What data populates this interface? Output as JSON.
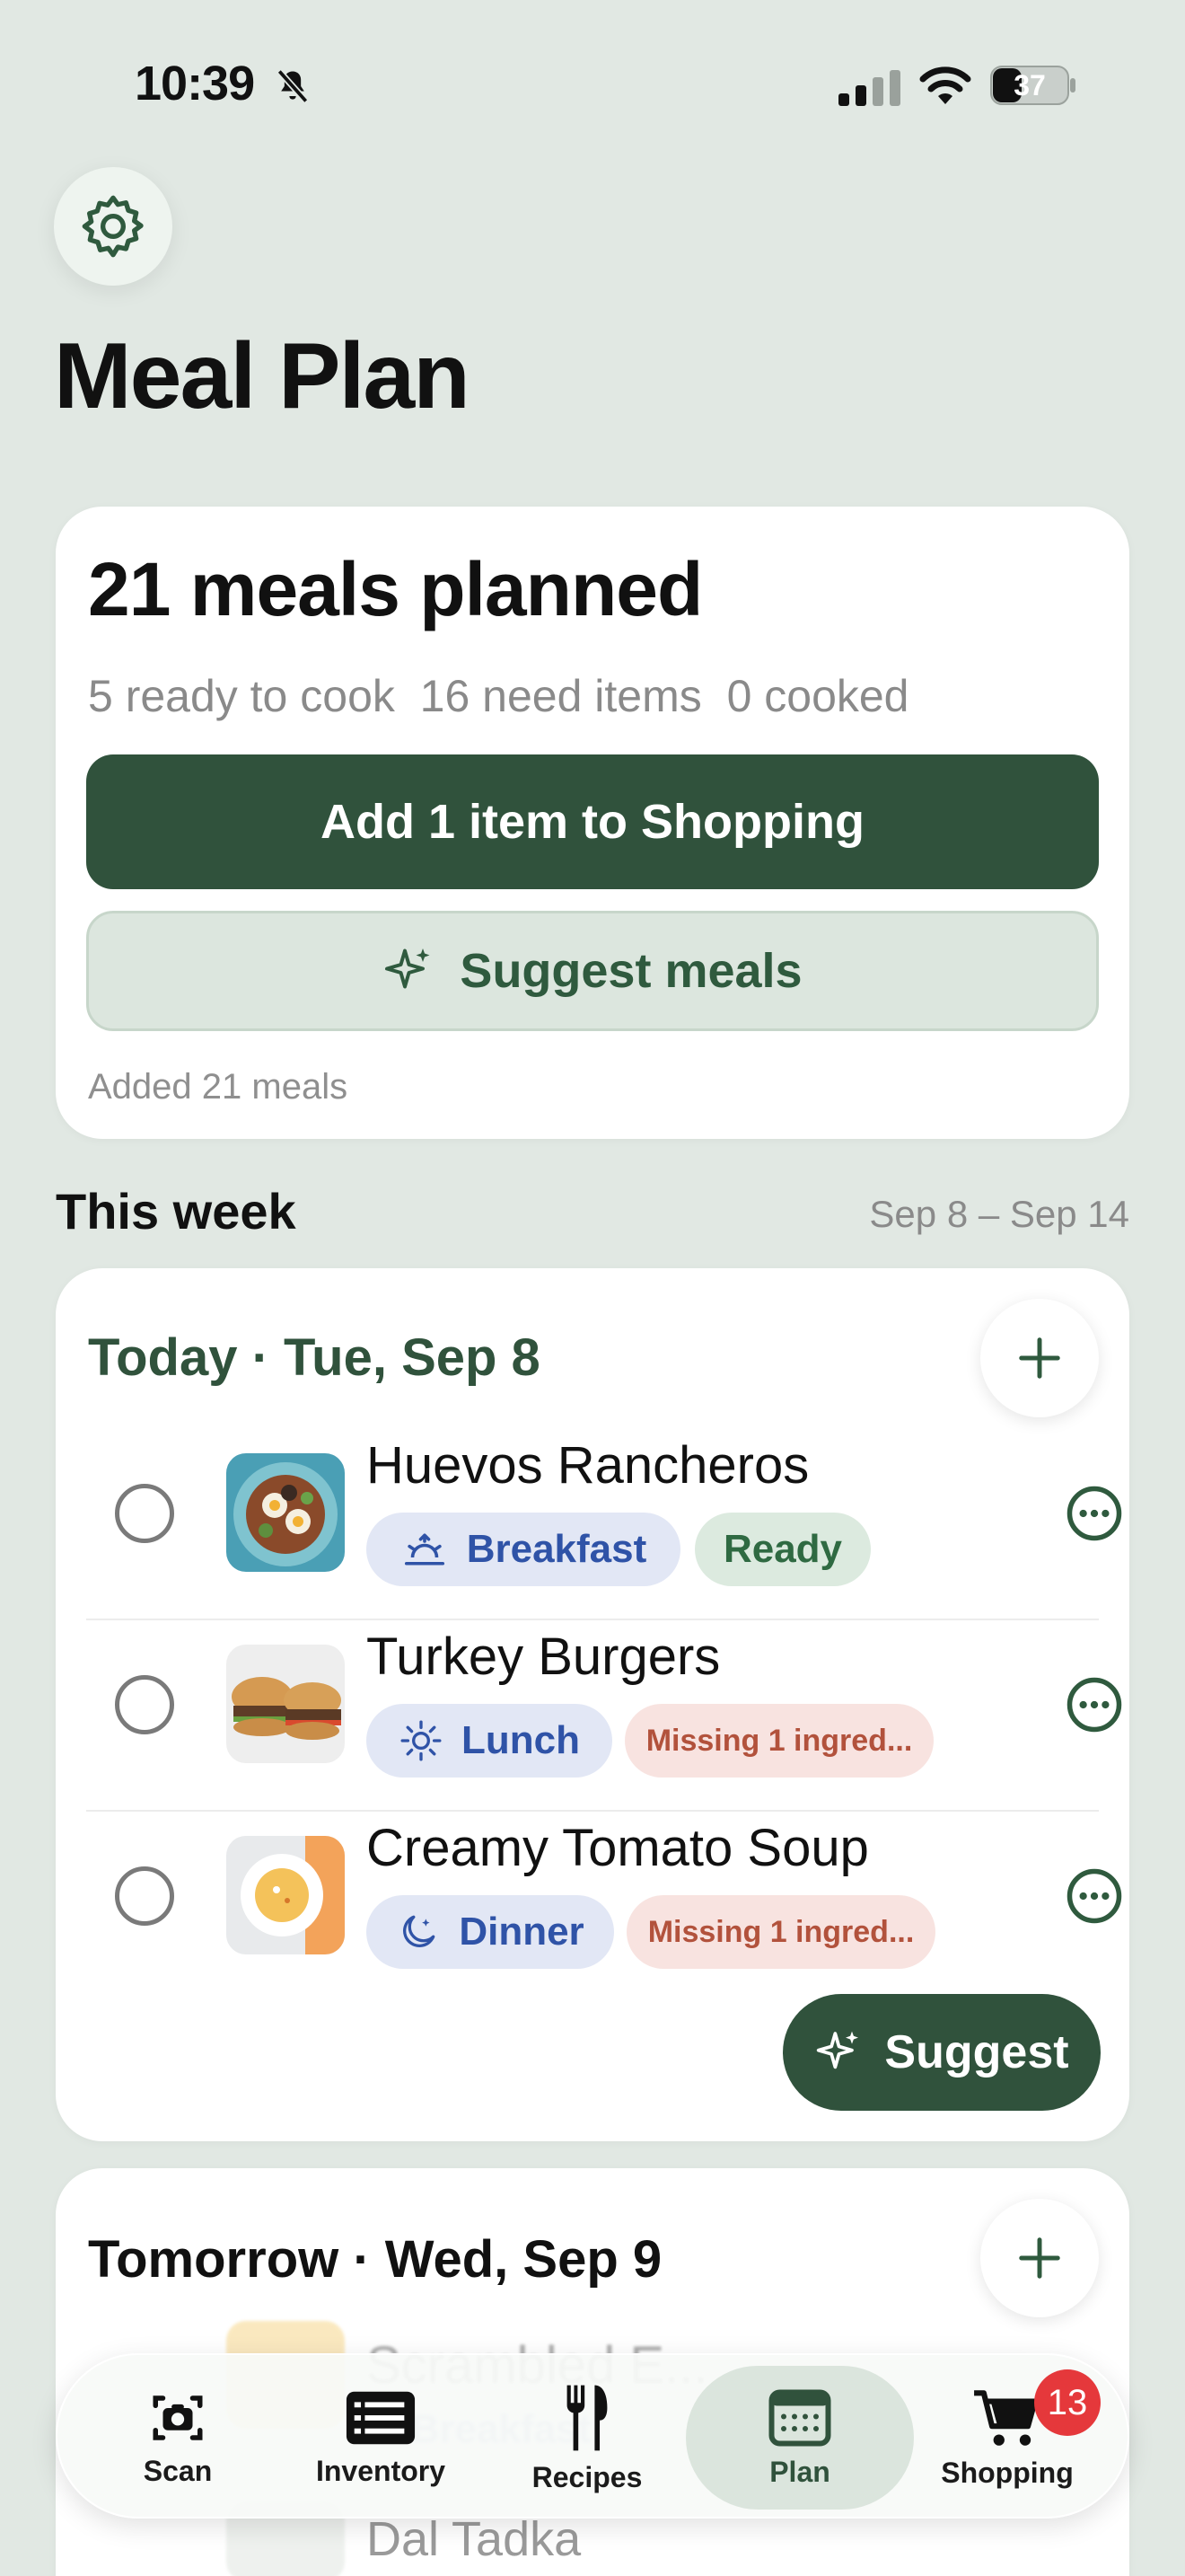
{
  "status_bar": {
    "time": "10:39",
    "battery": "37"
  },
  "header": {
    "title": "Meal Plan"
  },
  "summary": {
    "title": "21 meals planned",
    "stats": [
      "5 ready to cook",
      "16 need items",
      "0 cooked"
    ],
    "primary_button": "Add 1 item to Shopping",
    "secondary_button": "Suggest meals",
    "note": "Added 21 meals"
  },
  "week": {
    "title": "This week",
    "range": "Sep 8 – Sep 14"
  },
  "today": {
    "title": "Today · Tue, Sep 8",
    "meals": [
      {
        "name": "Huevos Rancheros",
        "type": "Breakfast",
        "type_icon": "sunrise-icon",
        "status": "Ready",
        "status_kind": "ready"
      },
      {
        "name": "Turkey Burgers",
        "type": "Lunch",
        "type_icon": "sun-icon",
        "status": "Missing 1 ingred...",
        "status_kind": "missing"
      },
      {
        "name": "Creamy Tomato Soup",
        "type": "Dinner",
        "type_icon": "moon-icon",
        "status": "Missing 1 ingred...",
        "status_kind": "missing"
      }
    ],
    "suggest_label": "Suggest"
  },
  "tomorrow": {
    "title": "Tomorrow · Wed, Sep 9",
    "partial_meal": "Scrambled E...",
    "partial_type": "Breakfast",
    "last_meal": "Dal Tadka"
  },
  "tabbar": {
    "tabs": [
      {
        "label": "Scan",
        "icon": "camera-icon"
      },
      {
        "label": "Inventory",
        "icon": "list-icon"
      },
      {
        "label": "Recipes",
        "icon": "fork-knife-icon"
      },
      {
        "label": "Plan",
        "icon": "calendar-icon",
        "active": true
      },
      {
        "label": "Shopping",
        "icon": "cart-icon"
      }
    ],
    "shopping_badge": "13"
  },
  "colors": {
    "background": "#e1e8e3",
    "primary_green": "#30523c",
    "meal_type_blue": "#2f53a7",
    "ready_bg": "#dceadf",
    "missing_bg": "#f8e3e0",
    "badge_red": "#e5383b"
  }
}
